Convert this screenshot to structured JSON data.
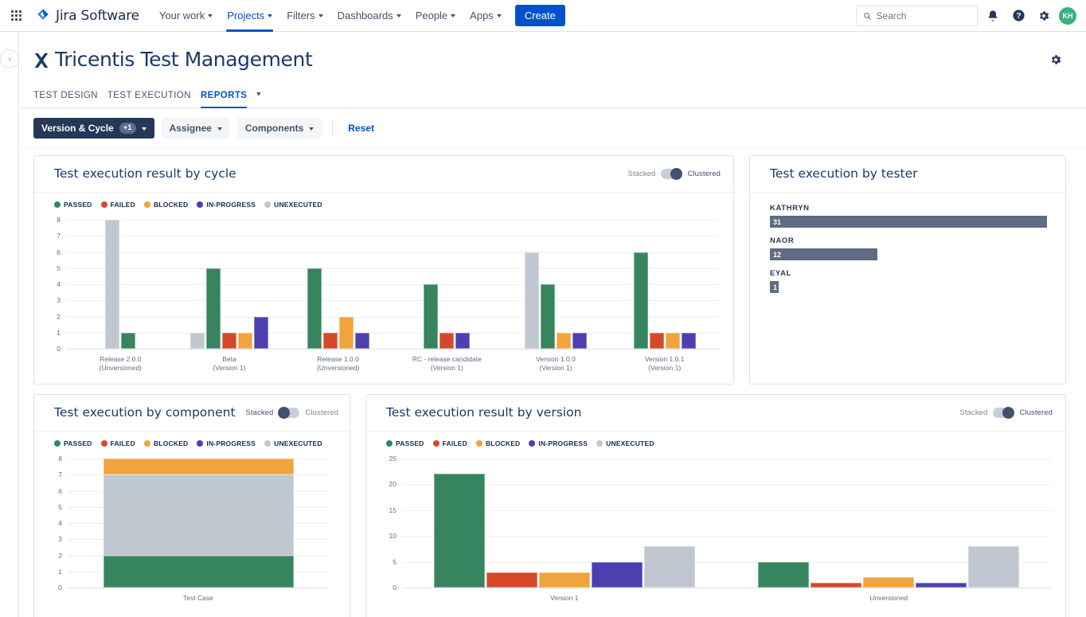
{
  "topnav": {
    "apps_icon": "apps-grid-icon",
    "brand": "Jira Software",
    "items": [
      {
        "label": "Your work",
        "active": false
      },
      {
        "label": "Projects",
        "active": true
      },
      {
        "label": "Filters",
        "active": false
      },
      {
        "label": "Dashboards",
        "active": false
      },
      {
        "label": "People",
        "active": false
      },
      {
        "label": "Apps",
        "active": false
      }
    ],
    "create_label": "Create",
    "search_placeholder": "Search",
    "search_value": "",
    "avatar_initials": "KH",
    "icons": [
      "notifications-bell-icon",
      "help-icon",
      "settings-gear-icon"
    ]
  },
  "page": {
    "app_title": "Tricentis Test Management",
    "tabs": [
      {
        "label": "TEST DESIGN",
        "active": false
      },
      {
        "label": "TEST EXECUTION",
        "active": false
      },
      {
        "label": "REPORTS",
        "active": true
      }
    ],
    "tab_more_icon": "chevron-down-icon",
    "settings_icon": "gear-icon",
    "rail_toggle_icon": "chevron-right-icon"
  },
  "filters": {
    "version_cycle": {
      "label": "Version & Cycle",
      "badge": "+1"
    },
    "assignee": {
      "label": "Assignee"
    },
    "components": {
      "label": "Components"
    },
    "reset": "Reset"
  },
  "legend": [
    {
      "label": "PASSED",
      "color": "#36855f"
    },
    {
      "label": "FAILED",
      "color": "#d54829"
    },
    {
      "label": "BLOCKED",
      "color": "#f1a33d"
    },
    {
      "label": "IN-PROGRESS",
      "color": "#4e3fb0"
    },
    {
      "label": "UNEXECUTED",
      "color": "#c1c7d0"
    }
  ],
  "toggle": {
    "stacked": "Stacked",
    "clustered": "Clustered"
  },
  "cards": {
    "cycle": {
      "title": "Test execution result by cycle",
      "mode": "clustered"
    },
    "tester": {
      "title": "Test execution by tester"
    },
    "component": {
      "title": "Test execution by component",
      "mode": "stacked"
    },
    "version": {
      "title": "Test execution result by version",
      "mode": "clustered"
    }
  },
  "tester_rows": [
    {
      "name": "KATHRYN",
      "value": "31",
      "max": 31
    },
    {
      "name": "NAOR",
      "value": "12",
      "max": 31
    },
    {
      "name": "EYAL",
      "value": "1",
      "max": 31
    }
  ],
  "chart_data": [
    {
      "id": "cycle",
      "type": "bar",
      "title": "Test execution result by cycle",
      "mode": "clustered",
      "xlabel": "",
      "ylabel": "",
      "ylim": [
        0,
        8
      ],
      "yticks": [
        0,
        1,
        2,
        3,
        4,
        5,
        6,
        7,
        8
      ],
      "grid": true,
      "categories": [
        "Release 2.0.0\n(Unversioned)",
        "Beta\n(Version 1)",
        "Release 1.0.0\n(Unversioned)",
        "RC - release candidate\n(Version 1)",
        "Version 1.0.0\n(Version 1)",
        "Version 1.0.1\n(Version 1)"
      ],
      "series": [
        {
          "name": "UNEXECUTED",
          "color": "#c1c7d0",
          "values": [
            8,
            1,
            0,
            0,
            6,
            0
          ]
        },
        {
          "name": "PASSED",
          "color": "#36855f",
          "values": [
            1,
            5,
            5,
            4,
            4,
            6
          ]
        },
        {
          "name": "FAILED",
          "color": "#d54829",
          "values": [
            0,
            1,
            1,
            1,
            0,
            1
          ]
        },
        {
          "name": "BLOCKED",
          "color": "#f1a33d",
          "values": [
            0,
            1,
            2,
            0,
            1,
            1
          ]
        },
        {
          "name": "IN-PROGRESS",
          "color": "#4e3fb0",
          "values": [
            0,
            2,
            1,
            1,
            1,
            1
          ]
        }
      ]
    },
    {
      "id": "component",
      "type": "bar",
      "title": "Test execution by component",
      "mode": "stacked",
      "xlabel": "Test Case",
      "ylabel": "",
      "ylim": [
        0,
        8
      ],
      "yticks": [
        0,
        1,
        2,
        3,
        4,
        5,
        6,
        7,
        8
      ],
      "grid": true,
      "categories": [
        "Test Case"
      ],
      "series": [
        {
          "name": "PASSED",
          "color": "#36855f",
          "values": [
            2
          ]
        },
        {
          "name": "UNEXECUTED",
          "color": "#c1c7d0",
          "values": [
            5
          ]
        },
        {
          "name": "BLOCKED",
          "color": "#f1a33d",
          "values": [
            1
          ]
        }
      ]
    },
    {
      "id": "version",
      "type": "bar",
      "title": "Test execution result by version",
      "mode": "clustered",
      "xlabel": "",
      "ylabel": "",
      "ylim": [
        0,
        25
      ],
      "yticks": [
        0,
        5,
        10,
        15,
        20,
        25
      ],
      "grid": true,
      "categories": [
        "Version 1",
        "Unversioned"
      ],
      "series": [
        {
          "name": "PASSED",
          "color": "#36855f",
          "values": [
            22,
            5
          ]
        },
        {
          "name": "FAILED",
          "color": "#d54829",
          "values": [
            3,
            1
          ]
        },
        {
          "name": "BLOCKED",
          "color": "#f1a33d",
          "values": [
            3,
            2
          ]
        },
        {
          "name": "IN-PROGRESS",
          "color": "#4e3fb0",
          "values": [
            5,
            1
          ]
        },
        {
          "name": "UNEXECUTED",
          "color": "#c1c7d0",
          "values": [
            8,
            8
          ]
        }
      ]
    },
    {
      "id": "tester",
      "type": "bar",
      "title": "Test execution by tester",
      "orientation": "horizontal",
      "categories": [
        "KATHRYN",
        "NAOR",
        "EYAL"
      ],
      "values": [
        31,
        12,
        1
      ],
      "color": "#5e6c84"
    }
  ]
}
